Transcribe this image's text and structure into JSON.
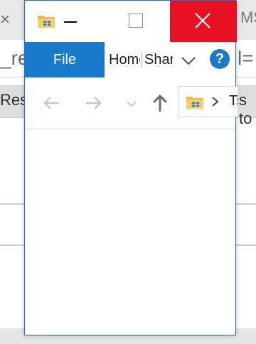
{
  "background": {
    "tab_close_glyph": "×",
    "tab_right_text": "MS",
    "address_left_text": "_re",
    "address_right_text": "l=",
    "button_left_text": "Rese",
    "button_right_text": "s to"
  },
  "window": {
    "title": "",
    "icon": "folder-dropbox-icon",
    "accent_color": "#1979ca",
    "close_color": "#e81123"
  },
  "ribbon": {
    "file_label": "File",
    "tabs": [
      {
        "label": "Home"
      },
      {
        "label": "Share"
      }
    ],
    "help_label": "?"
  },
  "address_bar": {
    "path_text": "Ts to"
  }
}
